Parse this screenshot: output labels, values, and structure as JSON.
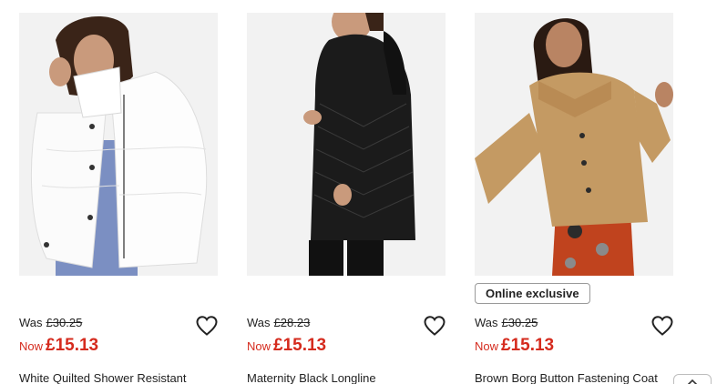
{
  "colors": {
    "price_red": "#d52b1e",
    "text": "#222222",
    "badge_border": "#9a9a9a",
    "image_bg": "#f2f2f2"
  },
  "products": [
    {
      "was_label": "Was",
      "was_price": "£30.25",
      "now_label": "Now",
      "now_price": "£15.13",
      "title": "White Quilted Shower Resistant",
      "favourite_icon": "heart-outline-icon",
      "image_desc": "woman-in-white-puffer-jacket"
    },
    {
      "was_label": "Was",
      "was_price": "£28.23",
      "now_label": "Now",
      "now_price": "£15.13",
      "title": "Maternity Black Longline",
      "favourite_icon": "heart-outline-icon",
      "image_desc": "woman-in-black-longline-padded-coat"
    },
    {
      "badge": "Online exclusive",
      "was_label": "Was",
      "was_price": "£30.25",
      "now_label": "Now",
      "now_price": "£15.13",
      "title": "Brown Borg Button Fastening Coat",
      "favourite_icon": "heart-outline-icon",
      "image_desc": "woman-in-brown-borg-coat"
    }
  ],
  "scroll_button_icon": "chevron-up-icon"
}
